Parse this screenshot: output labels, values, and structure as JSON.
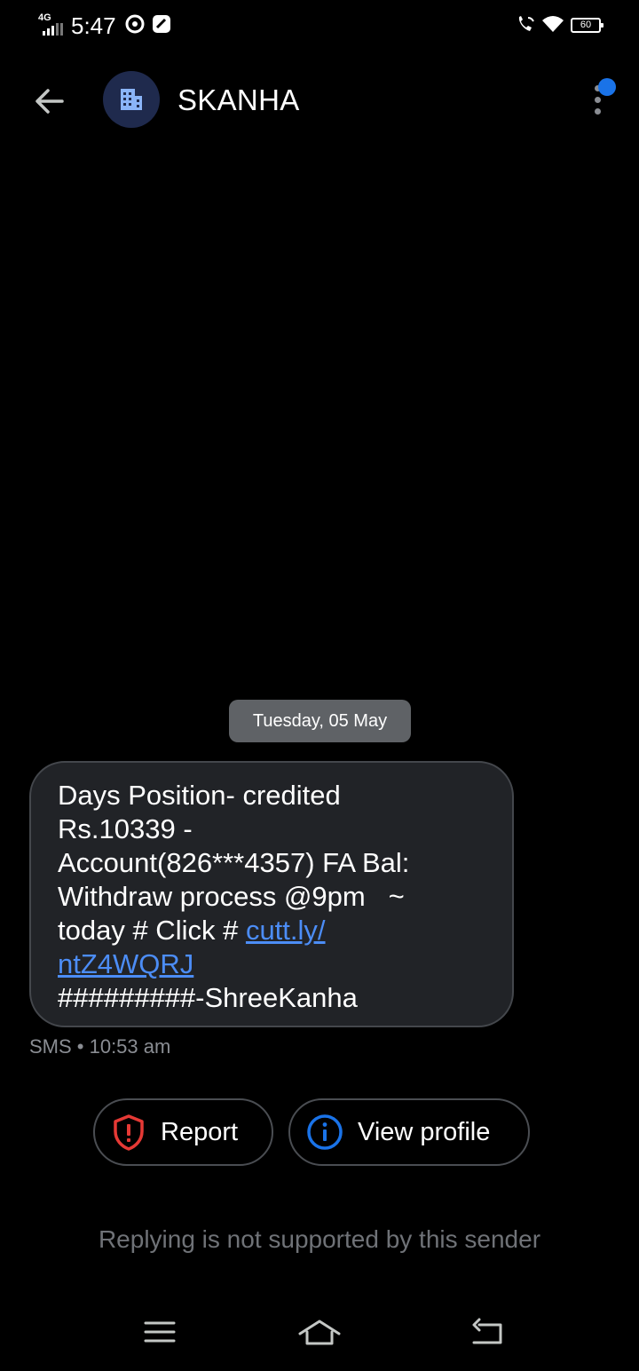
{
  "status_bar": {
    "network": "4G",
    "time": "5:47",
    "battery": "60",
    "icons": [
      "signal-icon",
      "messenger-icon",
      "chat-app-icon",
      "wifi-call-icon",
      "wifi-icon",
      "battery-icon"
    ]
  },
  "header": {
    "sender": "SKANHA",
    "avatar_icon": "building-icon",
    "back_icon": "arrow-left-icon",
    "menu_icon": "more-vertical-icon"
  },
  "conversation": {
    "date": "Tuesday, 05 May",
    "message": {
      "line1": "Days Position- credited",
      "line2": "Rs.10339 -",
      "line3": "Account(826***4357) FA Bal:",
      "line4": "Withdraw process @9pm   ~",
      "line5_prefix": "today # Click # ",
      "link_part1": "cutt.ly/",
      "link_part2": "ntZ4WQRJ",
      "line7": "#########-ShreeKanha"
    },
    "meta": "SMS • 10:53 am"
  },
  "actions": {
    "report_label": "Report",
    "view_profile_label": "View profile"
  },
  "footer": {
    "reply_note": "Replying is not supported by this sender"
  },
  "colors": {
    "background": "#000000",
    "bubble": "#212327",
    "link": "#4c8df6",
    "report_icon": "#e53935",
    "info_icon": "#1a73e8",
    "avatar_bg": "#1f2a4d",
    "avatar_icon": "#8ab4f8"
  }
}
